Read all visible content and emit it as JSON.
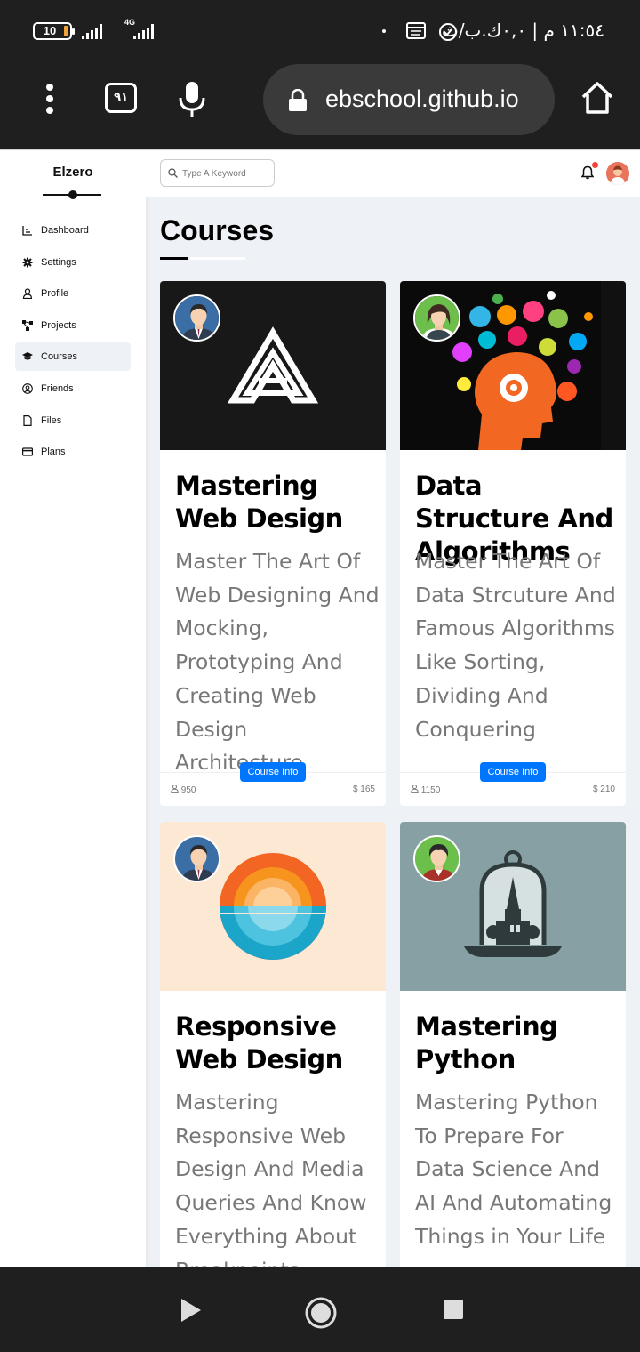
{
  "status_bar": {
    "battery": "10",
    "network": "4G",
    "time_rtl": "١١:٥٤ م | ٠,٠ك.ب/ث"
  },
  "browser": {
    "tabs_count": "٩١",
    "url": "ebschool.github.io"
  },
  "sidebar": {
    "brand": "Elzero",
    "items": [
      {
        "label": "Dashboard",
        "icon": "chart-icon"
      },
      {
        "label": "Settings",
        "icon": "gear-icon"
      },
      {
        "label": "Profile",
        "icon": "user-icon"
      },
      {
        "label": "Projects",
        "icon": "diagram-icon"
      },
      {
        "label": "Courses",
        "icon": "graduation-cap-icon",
        "active": true
      },
      {
        "label": "Friends",
        "icon": "user-circle-icon"
      },
      {
        "label": "Files",
        "icon": "file-icon"
      },
      {
        "label": "Plans",
        "icon": "credit-card-icon"
      }
    ]
  },
  "topbar": {
    "search_placeholder": "Type A Keyword"
  },
  "page": {
    "title": "Courses"
  },
  "courses": [
    {
      "title": "Mastering Web Design",
      "description": "Master The Art Of Web Designing And Mocking, Prototyping And Creating Web Design Architecture",
      "button": "Course Info",
      "students": "950",
      "price": "$ 165"
    },
    {
      "title": "Data Structure And Algorithms",
      "description": "Master The Art Of Data Strcuture And Famous Algorithms Like Sorting, Dividing And Conquering",
      "button": "Course Info",
      "students": "1150",
      "price": "$ 210"
    },
    {
      "title": "Responsive Web Design",
      "description": "Mastering Responsive Web Design And Media Queries And Know Everything About Breakpoints"
    },
    {
      "title": "Mastering Python",
      "description": "Mastering Python To Prepare For Data Science And AI And Automating Things in Your Life"
    }
  ],
  "colors": {
    "accent": "#0075ff",
    "page_bg": "#eef1f5",
    "notification": "#f44336"
  }
}
